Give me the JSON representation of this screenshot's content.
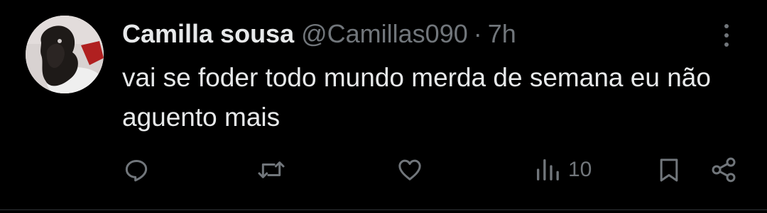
{
  "tweet": {
    "display_name": "Camilla sousa",
    "handle": "@Camillas090",
    "separator": "·",
    "time": "7h",
    "text": "vai se foder todo mundo merda de semana eu não aguento mais",
    "more_icon": "more-vertical-icon"
  },
  "actions": {
    "reply_icon": "reply-icon",
    "retweet_icon": "retweet-icon",
    "like_icon": "heart-icon",
    "views_icon": "views-icon",
    "views_count": "10",
    "bookmark_icon": "bookmark-icon",
    "share_icon": "share-icon"
  },
  "colors": {
    "background": "#000000",
    "text_primary": "#e7e9ea",
    "text_secondary": "#71767b"
  }
}
